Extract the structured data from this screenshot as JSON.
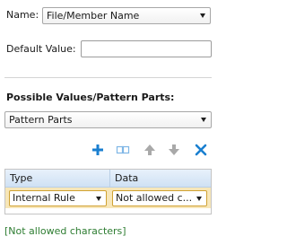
{
  "name_field": {
    "label": "Name:",
    "selected": "File/Member Name"
  },
  "default_value": {
    "label": "Default Value:",
    "value": ""
  },
  "possible_values": {
    "heading": "Possible Values/Pattern Parts:",
    "selected": "Pattern Parts"
  },
  "toolbar": {
    "icons": [
      "add-icon",
      "duplicate-icon",
      "move-up-icon",
      "move-down-icon",
      "delete-icon"
    ],
    "colors": {
      "add": "#1a7fd0",
      "duplicate": "#7fb6e6",
      "arrows": "#a9a9a9",
      "delete": "#1a7fd0"
    }
  },
  "grid": {
    "columns": [
      "Type",
      "Data"
    ],
    "rows": [
      {
        "type": "Internal Rule",
        "data": "Not allowed c..."
      }
    ],
    "colors": {
      "header": "#d9e8f7",
      "selected_row": "#f7e6b8",
      "cell_border": "#d0a233"
    }
  },
  "preview_text": "[Not allowed characters]",
  "colors": {
    "preview": "#2e7d32"
  }
}
